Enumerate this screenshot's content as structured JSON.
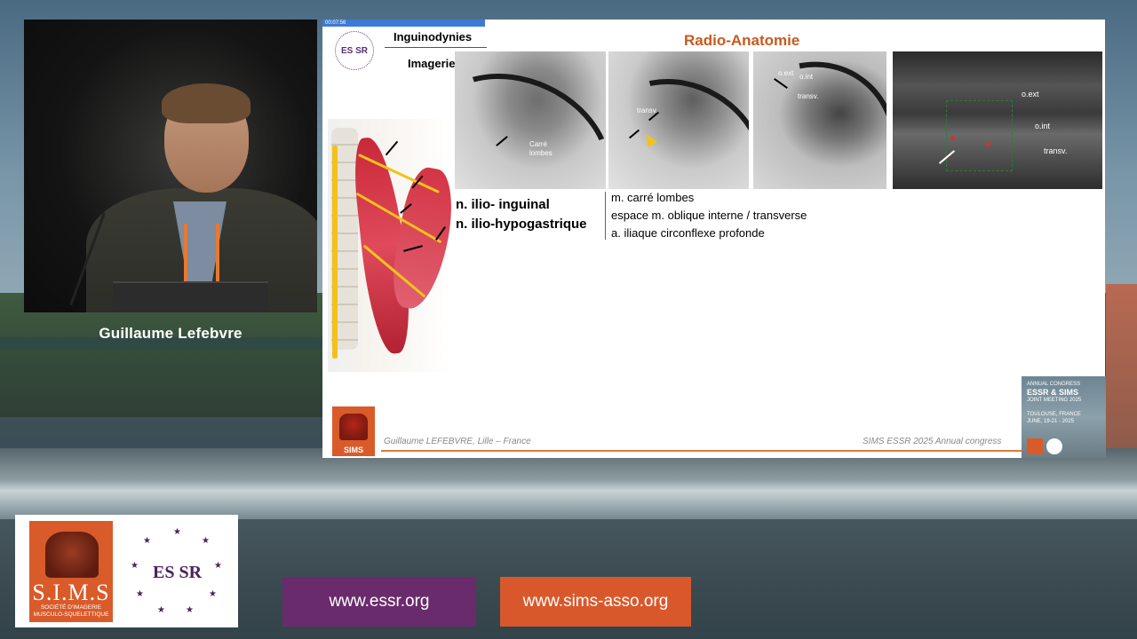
{
  "speaker": {
    "name": "Guillaume Lefebvre"
  },
  "slide": {
    "timer": "00:07:56",
    "section_title": "Inguinodynies",
    "subsection_title": "Imagerie",
    "main_title": "Radio-Anatomie",
    "mri_labels": {
      "img1": "Carré\nlombes",
      "img2": "transv.",
      "img3_ext": "o.ext",
      "img3_int": "o.int",
      "img3_transv": "transv.",
      "us_ext": "o.ext",
      "us_int": "o.int",
      "us_transv": "transv."
    },
    "nerves": [
      "n.  ilio- inguinal",
      "n.  ilio-hypogastrique"
    ],
    "details": [
      "m. carré lombes",
      "espace m. oblique interne / transverse",
      "a. iliaque circonflexe profonde"
    ],
    "footer_left": "Guillaume LEFEBVRE, Lille – France",
    "footer_right": "SIMS ESSR 2025 Annual congress",
    "accent_color": "#c65a1e"
  },
  "congress_badge": {
    "line1": "ANNUAL CONGRESS",
    "line2": "ESSR & SIMS",
    "line3": "JOINT MEETING 2025",
    "line4": "TOULOUSE, FRANCE",
    "line5": "JUNE, 19-21 - 2025"
  },
  "bottom": {
    "sims_word": "S.I.M.S",
    "sims_sub": "SOCIÉTÉ D'IMAGERIE\nMUSCULO-SQUELETTIQUE",
    "essr_word": "ES  SR",
    "url_essr": "www.essr.org",
    "url_sims": "www.sims-asso.org",
    "essr_color": "#6a2b6c",
    "sims_color": "#d9582b"
  }
}
